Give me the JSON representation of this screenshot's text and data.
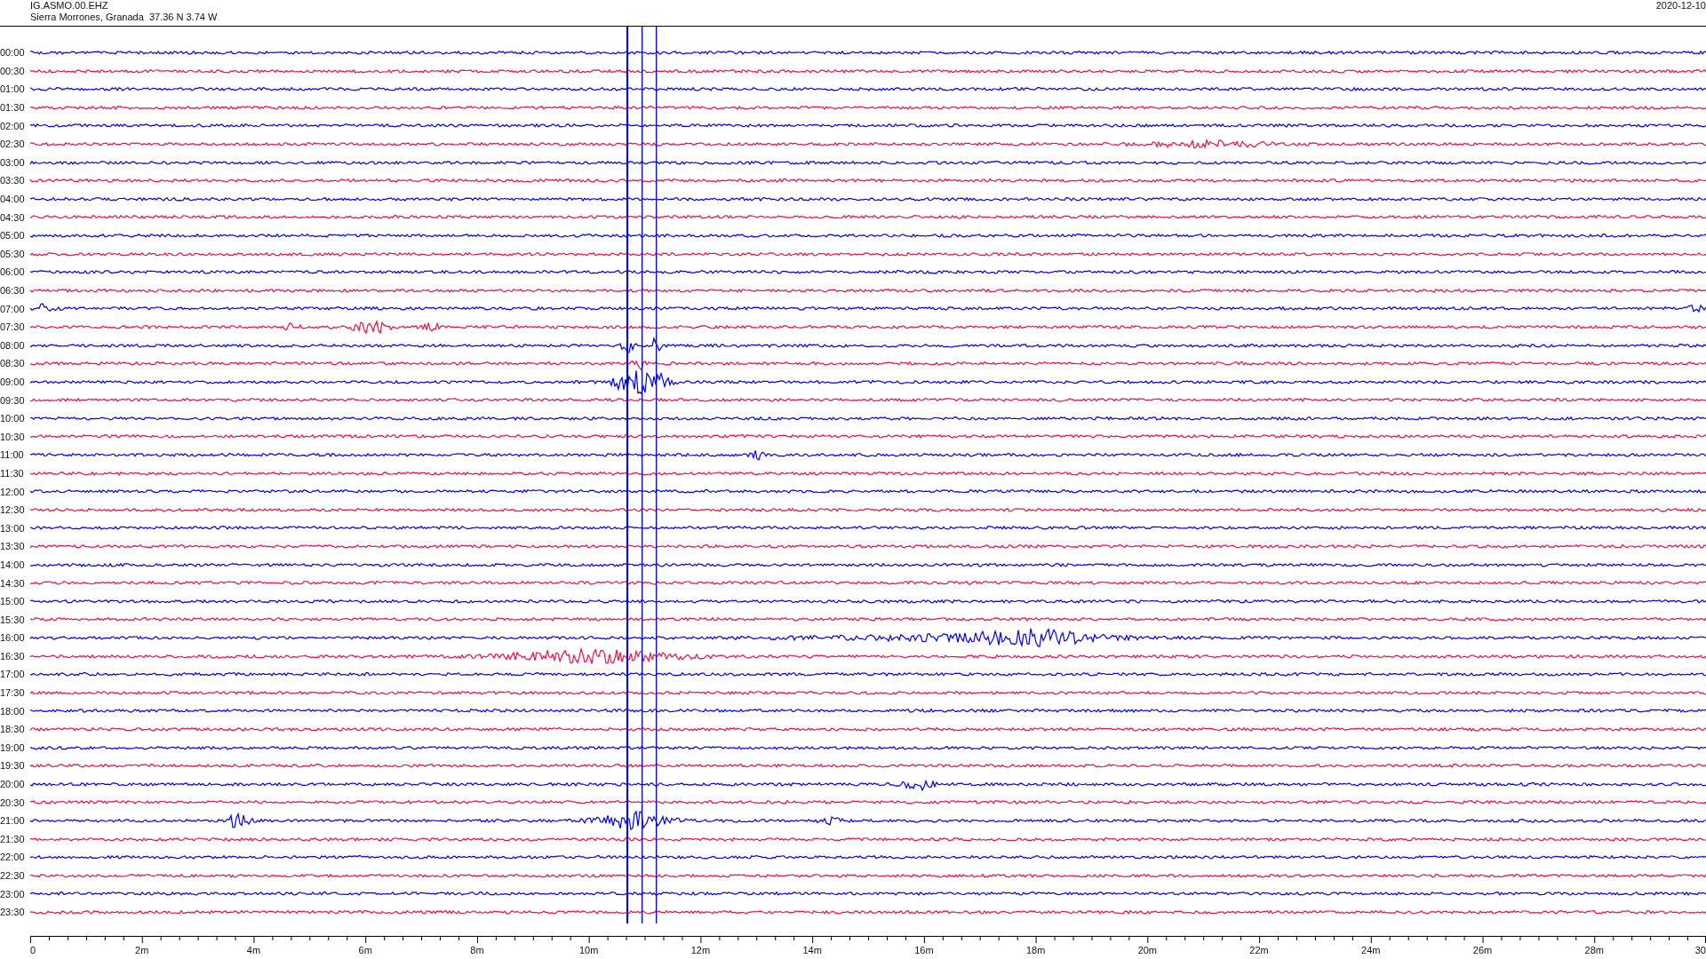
{
  "header": {
    "station": "IG.ASMO.00.EHZ",
    "location": "Sierra Morrones, Granada  37.36 N 3.74 W",
    "date": "2020-12-10"
  },
  "rows": [
    {
      "label": "00:00",
      "color": "#0000ee"
    },
    {
      "label": "00:30",
      "color": "#ee1144"
    },
    {
      "label": "01:00",
      "color": "#0000ee"
    },
    {
      "label": "01:30",
      "color": "#ee1144"
    },
    {
      "label": "02:00",
      "color": "#0000ee"
    },
    {
      "label": "02:30",
      "color": "#ee1144"
    },
    {
      "label": "03:00",
      "color": "#0000ee"
    },
    {
      "label": "03:30",
      "color": "#ee1144"
    },
    {
      "label": "04:00",
      "color": "#0000ee"
    },
    {
      "label": "04:30",
      "color": "#ee1144"
    },
    {
      "label": "05:00",
      "color": "#0000ee"
    },
    {
      "label": "05:30",
      "color": "#ee1144"
    },
    {
      "label": "06:00",
      "color": "#0000ee"
    },
    {
      "label": "06:30",
      "color": "#ee1144"
    },
    {
      "label": "07:00",
      "color": "#0000ee"
    },
    {
      "label": "07:30",
      "color": "#ee1144"
    },
    {
      "label": "08:00",
      "color": "#0000ee"
    },
    {
      "label": "08:30",
      "color": "#ee1144"
    },
    {
      "label": "09:00",
      "color": "#0000ee"
    },
    {
      "label": "09:30",
      "color": "#ee1144"
    },
    {
      "label": "10:00",
      "color": "#0000ee"
    },
    {
      "label": "10:30",
      "color": "#ee1144"
    },
    {
      "label": "11:00",
      "color": "#0000ee"
    },
    {
      "label": "11:30",
      "color": "#ee1144"
    },
    {
      "label": "12:00",
      "color": "#0000ee"
    },
    {
      "label": "12:30",
      "color": "#ee1144"
    },
    {
      "label": "13:00",
      "color": "#0000ee"
    },
    {
      "label": "13:30",
      "color": "#ee1144"
    },
    {
      "label": "14:00",
      "color": "#0000ee"
    },
    {
      "label": "14:30",
      "color": "#ee1144"
    },
    {
      "label": "15:00",
      "color": "#0000ee"
    },
    {
      "label": "15:30",
      "color": "#ee1144"
    },
    {
      "label": "16:00",
      "color": "#0000ee"
    },
    {
      "label": "16:30",
      "color": "#ee1144"
    },
    {
      "label": "17:00",
      "color": "#0000ee"
    },
    {
      "label": "17:30",
      "color": "#ee1144"
    },
    {
      "label": "18:00",
      "color": "#0000ee"
    },
    {
      "label": "18:30",
      "color": "#ee1144"
    },
    {
      "label": "19:00",
      "color": "#0000ee"
    },
    {
      "label": "19:30",
      "color": "#ee1144"
    },
    {
      "label": "20:00",
      "color": "#0000ee"
    },
    {
      "label": "20:30",
      "color": "#ee1144"
    },
    {
      "label": "21:00",
      "color": "#0000ee"
    },
    {
      "label": "21:30",
      "color": "#ee1144"
    },
    {
      "label": "22:00",
      "color": "#0000ee"
    },
    {
      "label": "22:30",
      "color": "#ee1144"
    },
    {
      "label": "23:00",
      "color": "#0000ee"
    },
    {
      "label": "23:30",
      "color": "#ee1144"
    }
  ],
  "x_axis": {
    "ticks": [
      "0",
      "2m",
      "4m",
      "6m",
      "8m",
      "10m",
      "12m",
      "14m",
      "16m",
      "18m",
      "20m",
      "22m",
      "24m",
      "26m",
      "28m",
      "30"
    ]
  }
}
